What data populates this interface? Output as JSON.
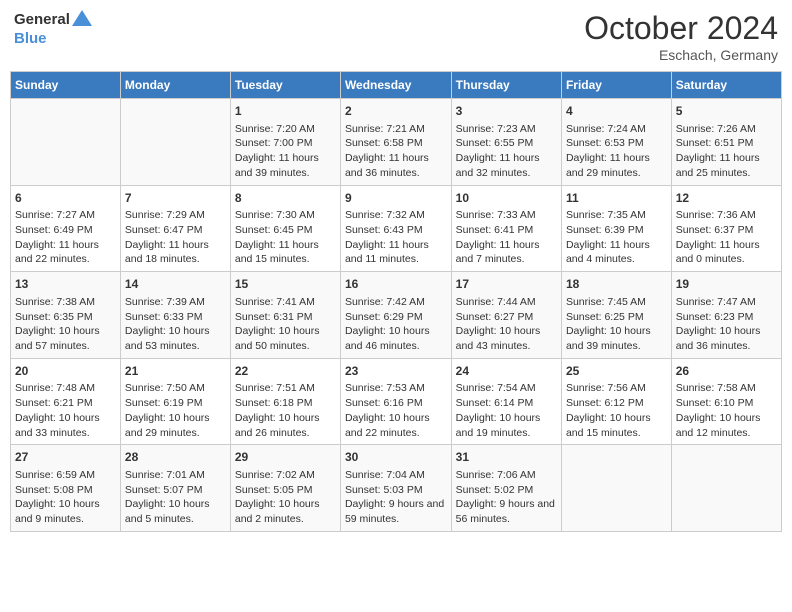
{
  "header": {
    "logo_general": "General",
    "logo_blue": "Blue",
    "month": "October 2024",
    "location": "Eschach, Germany"
  },
  "days_of_week": [
    "Sunday",
    "Monday",
    "Tuesday",
    "Wednesday",
    "Thursday",
    "Friday",
    "Saturday"
  ],
  "weeks": [
    [
      {
        "day": "",
        "content": ""
      },
      {
        "day": "",
        "content": ""
      },
      {
        "day": "1",
        "content": "Sunrise: 7:20 AM\nSunset: 7:00 PM\nDaylight: 11 hours and 39 minutes."
      },
      {
        "day": "2",
        "content": "Sunrise: 7:21 AM\nSunset: 6:58 PM\nDaylight: 11 hours and 36 minutes."
      },
      {
        "day": "3",
        "content": "Sunrise: 7:23 AM\nSunset: 6:55 PM\nDaylight: 11 hours and 32 minutes."
      },
      {
        "day": "4",
        "content": "Sunrise: 7:24 AM\nSunset: 6:53 PM\nDaylight: 11 hours and 29 minutes."
      },
      {
        "day": "5",
        "content": "Sunrise: 7:26 AM\nSunset: 6:51 PM\nDaylight: 11 hours and 25 minutes."
      }
    ],
    [
      {
        "day": "6",
        "content": "Sunrise: 7:27 AM\nSunset: 6:49 PM\nDaylight: 11 hours and 22 minutes."
      },
      {
        "day": "7",
        "content": "Sunrise: 7:29 AM\nSunset: 6:47 PM\nDaylight: 11 hours and 18 minutes."
      },
      {
        "day": "8",
        "content": "Sunrise: 7:30 AM\nSunset: 6:45 PM\nDaylight: 11 hours and 15 minutes."
      },
      {
        "day": "9",
        "content": "Sunrise: 7:32 AM\nSunset: 6:43 PM\nDaylight: 11 hours and 11 minutes."
      },
      {
        "day": "10",
        "content": "Sunrise: 7:33 AM\nSunset: 6:41 PM\nDaylight: 11 hours and 7 minutes."
      },
      {
        "day": "11",
        "content": "Sunrise: 7:35 AM\nSunset: 6:39 PM\nDaylight: 11 hours and 4 minutes."
      },
      {
        "day": "12",
        "content": "Sunrise: 7:36 AM\nSunset: 6:37 PM\nDaylight: 11 hours and 0 minutes."
      }
    ],
    [
      {
        "day": "13",
        "content": "Sunrise: 7:38 AM\nSunset: 6:35 PM\nDaylight: 10 hours and 57 minutes."
      },
      {
        "day": "14",
        "content": "Sunrise: 7:39 AM\nSunset: 6:33 PM\nDaylight: 10 hours and 53 minutes."
      },
      {
        "day": "15",
        "content": "Sunrise: 7:41 AM\nSunset: 6:31 PM\nDaylight: 10 hours and 50 minutes."
      },
      {
        "day": "16",
        "content": "Sunrise: 7:42 AM\nSunset: 6:29 PM\nDaylight: 10 hours and 46 minutes."
      },
      {
        "day": "17",
        "content": "Sunrise: 7:44 AM\nSunset: 6:27 PM\nDaylight: 10 hours and 43 minutes."
      },
      {
        "day": "18",
        "content": "Sunrise: 7:45 AM\nSunset: 6:25 PM\nDaylight: 10 hours and 39 minutes."
      },
      {
        "day": "19",
        "content": "Sunrise: 7:47 AM\nSunset: 6:23 PM\nDaylight: 10 hours and 36 minutes."
      }
    ],
    [
      {
        "day": "20",
        "content": "Sunrise: 7:48 AM\nSunset: 6:21 PM\nDaylight: 10 hours and 33 minutes."
      },
      {
        "day": "21",
        "content": "Sunrise: 7:50 AM\nSunset: 6:19 PM\nDaylight: 10 hours and 29 minutes."
      },
      {
        "day": "22",
        "content": "Sunrise: 7:51 AM\nSunset: 6:18 PM\nDaylight: 10 hours and 26 minutes."
      },
      {
        "day": "23",
        "content": "Sunrise: 7:53 AM\nSunset: 6:16 PM\nDaylight: 10 hours and 22 minutes."
      },
      {
        "day": "24",
        "content": "Sunrise: 7:54 AM\nSunset: 6:14 PM\nDaylight: 10 hours and 19 minutes."
      },
      {
        "day": "25",
        "content": "Sunrise: 7:56 AM\nSunset: 6:12 PM\nDaylight: 10 hours and 15 minutes."
      },
      {
        "day": "26",
        "content": "Sunrise: 7:58 AM\nSunset: 6:10 PM\nDaylight: 10 hours and 12 minutes."
      }
    ],
    [
      {
        "day": "27",
        "content": "Sunrise: 6:59 AM\nSunset: 5:08 PM\nDaylight: 10 hours and 9 minutes."
      },
      {
        "day": "28",
        "content": "Sunrise: 7:01 AM\nSunset: 5:07 PM\nDaylight: 10 hours and 5 minutes."
      },
      {
        "day": "29",
        "content": "Sunrise: 7:02 AM\nSunset: 5:05 PM\nDaylight: 10 hours and 2 minutes."
      },
      {
        "day": "30",
        "content": "Sunrise: 7:04 AM\nSunset: 5:03 PM\nDaylight: 9 hours and 59 minutes."
      },
      {
        "day": "31",
        "content": "Sunrise: 7:06 AM\nSunset: 5:02 PM\nDaylight: 9 hours and 56 minutes."
      },
      {
        "day": "",
        "content": ""
      },
      {
        "day": "",
        "content": ""
      }
    ]
  ]
}
